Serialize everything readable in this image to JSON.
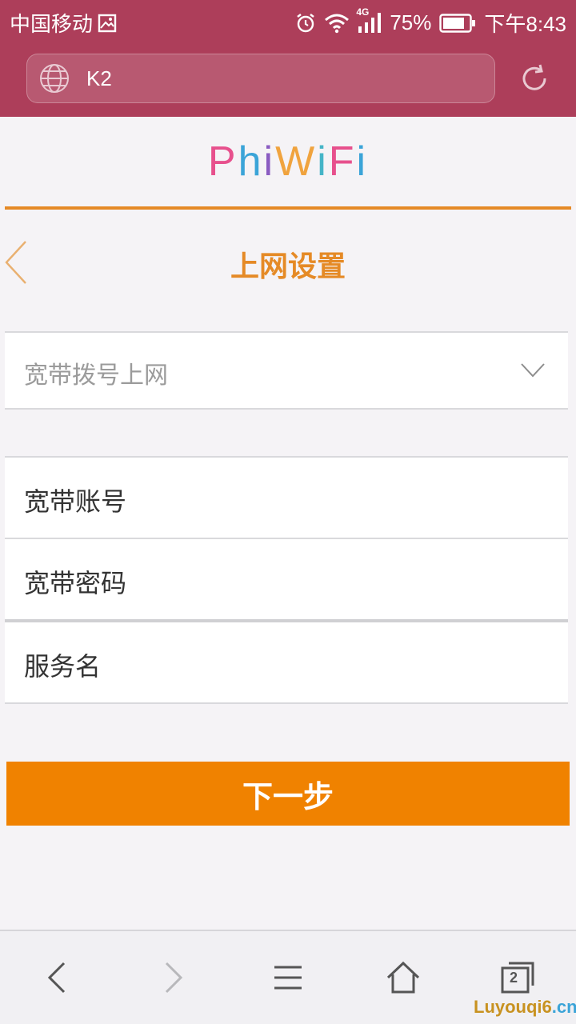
{
  "status_bar": {
    "carrier": "中国移动",
    "network": "4G",
    "battery": "75%",
    "time": "下午8:43",
    "icons": [
      "gallery-icon",
      "alarm-icon",
      "wifi-icon",
      "signal-icon",
      "battery-icon"
    ]
  },
  "browser": {
    "url": "K2",
    "icons": [
      "globe-icon",
      "reload-icon"
    ]
  },
  "page": {
    "logo": [
      "P",
      "h",
      "i",
      "W",
      "i",
      "F",
      "i"
    ],
    "title": "上网设置",
    "connection_type": {
      "selected": "宽带拨号上网"
    },
    "fields": [
      {
        "label": "宽带账号"
      },
      {
        "label": "宽带密码"
      },
      {
        "label": "服务名"
      }
    ],
    "next_button": "下一步"
  },
  "bottom_nav": {
    "tab_count": "2",
    "icons": [
      "back-arrow-icon",
      "forward-arrow-icon",
      "menu-icon",
      "home-icon",
      "tabs-icon"
    ]
  },
  "watermark": {
    "text_main": "Luyouqi6",
    "text_suffix": ".cn"
  },
  "colors": {
    "header": "#ad3e5a",
    "accent": "#e58a26",
    "button": "#f08200"
  }
}
